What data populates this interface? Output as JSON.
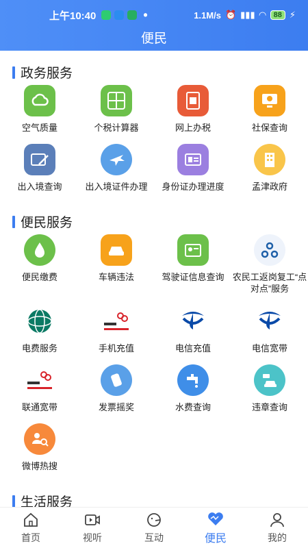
{
  "status": {
    "time": "上午10:40",
    "speed": "1.1M/s",
    "battery": "88"
  },
  "header": {
    "title": "便民"
  },
  "sections": [
    {
      "title": "政务服务",
      "items": [
        {
          "label": "空气质量",
          "icon": "cloud-icon",
          "color": "#6cc04a"
        },
        {
          "label": "个税计算器",
          "icon": "calculator-icon",
          "color": "#6cc04a"
        },
        {
          "label": "网上办税",
          "icon": "tax-icon",
          "color": "#e85b38"
        },
        {
          "label": "社保查询",
          "icon": "monitor-icon",
          "color": "#f7a21b"
        },
        {
          "label": "出入境查询",
          "icon": "id-card-pen-icon",
          "color": "#5b7fb9"
        },
        {
          "label": "出入境证件办理",
          "icon": "airplane-globe-icon",
          "color": "#5aa0e8"
        },
        {
          "label": "身份证办理进度",
          "icon": "id-card-icon",
          "color": "#9b7fe0"
        },
        {
          "label": "孟津政府",
          "icon": "building-icon",
          "color": "#f9c54a"
        }
      ]
    },
    {
      "title": "便民服务",
      "items": [
        {
          "label": "便民缴费",
          "icon": "water-drop-icon",
          "color": "#6cc04a"
        },
        {
          "label": "车辆违法",
          "icon": "car-icon",
          "color": "#f7a21b"
        },
        {
          "label": "驾驶证信息查询",
          "icon": "license-icon",
          "color": "#6cc04a"
        },
        {
          "label": "农民工返岗复工“点对点”服务",
          "icon": "network-icon",
          "color": "#ffffff"
        },
        {
          "label": "电费服务",
          "icon": "state-grid-logo",
          "color": "#ffffff"
        },
        {
          "label": "手机充值",
          "icon": "unicom-logo",
          "color": "#ffffff"
        },
        {
          "label": "电信充值",
          "icon": "telecom-logo",
          "color": "#ffffff"
        },
        {
          "label": "电信宽带",
          "icon": "telecom-logo",
          "color": "#ffffff"
        },
        {
          "label": "联通宽带",
          "icon": "unicom-logo",
          "color": "#ffffff"
        },
        {
          "label": "发票摇奖",
          "icon": "hand-shake-icon",
          "color": "#5aa0e8"
        },
        {
          "label": "水费查询",
          "icon": "faucet-icon",
          "color": "#3f8ee8"
        },
        {
          "label": "违章查询",
          "icon": "camera-car-icon",
          "color": "#4cc3c8"
        },
        {
          "label": "微博热搜",
          "icon": "people-search-icon",
          "color": "#f7893b"
        }
      ]
    },
    {
      "title": "生活服务",
      "items": []
    }
  ],
  "tabbar": [
    {
      "label": "首页",
      "icon": "home-icon",
      "active": false
    },
    {
      "label": "视听",
      "icon": "video-icon",
      "active": false
    },
    {
      "label": "互动",
      "icon": "chat-face-icon",
      "active": false
    },
    {
      "label": "便民",
      "icon": "heart-icon",
      "active": true
    },
    {
      "label": "我的",
      "icon": "user-icon",
      "active": false
    }
  ],
  "colors": {
    "accent": "#3c7df0"
  }
}
